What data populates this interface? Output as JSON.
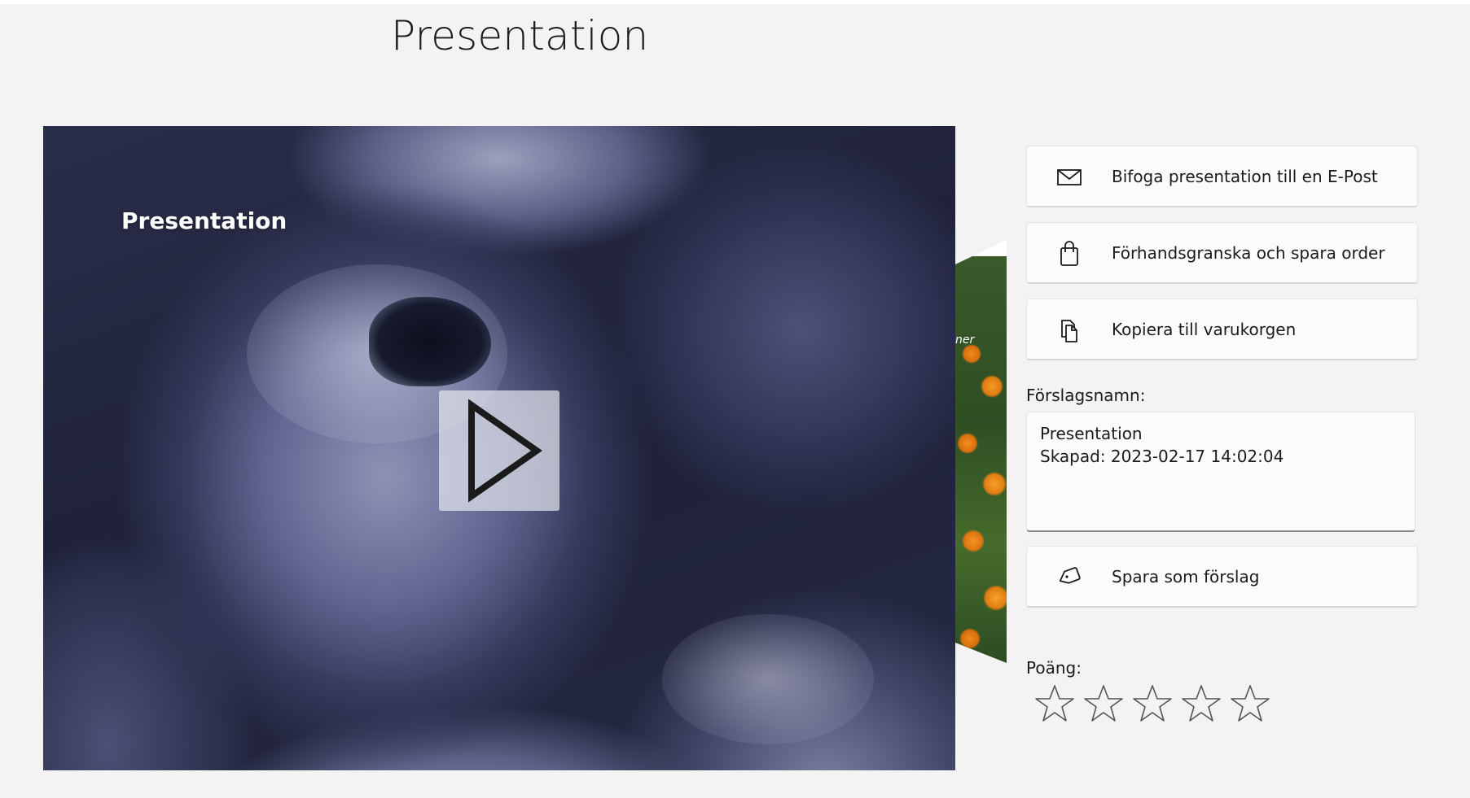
{
  "page": {
    "title": "Presentation"
  },
  "preview": {
    "slide_title": "Presentation",
    "next_slide_label": "ner"
  },
  "actions": {
    "email_label": "Bifoga presentation till en E-Post",
    "preview_order_label": "Förhandsgranska och spara order",
    "copy_cart_label": "Kopiera till varukorgen",
    "save_suggestion_label": "Spara som förslag"
  },
  "suggestion": {
    "label": "Förslagsnamn:",
    "name_line": "Presentation",
    "created_line": "Skapad: 2023-02-17 14:02:04"
  },
  "rating": {
    "label": "Poäng:",
    "value": 0,
    "max": 5
  },
  "icons": {
    "email": "mail-icon",
    "preview_order": "shopping-bag-icon",
    "copy_cart": "copy-icon",
    "save_suggestion": "tag-icon",
    "play": "play-icon",
    "star": "star-icon"
  }
}
